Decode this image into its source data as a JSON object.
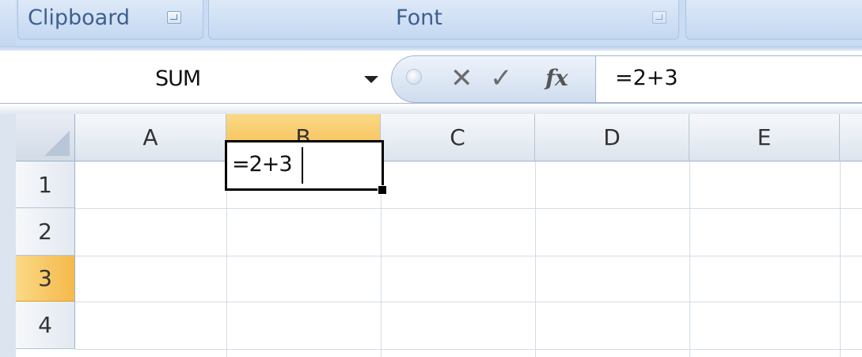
{
  "ribbon": {
    "groups": [
      {
        "label": "Clipboard"
      },
      {
        "label": "Font"
      }
    ]
  },
  "formula_bar": {
    "name_box_value": "SUM",
    "cancel_glyph": "✕",
    "enter_glyph": "✓",
    "fx_label": "fx",
    "formula": "=2+3"
  },
  "grid": {
    "columns": [
      "A",
      "B",
      "C",
      "D",
      "E"
    ],
    "rows": [
      "1",
      "2",
      "3",
      "4"
    ],
    "selected_column": "B",
    "selected_row": "3",
    "active_cell_text": "=2+3"
  },
  "colors": {
    "selected_header": "#f5b94a",
    "ribbon_bg": "#c9dcf3",
    "ribbon_text": "#3e5f8f"
  },
  "icons": [
    "dialog-launcher-icon",
    "dropdown-arrow-icon",
    "cancel-icon",
    "enter-icon",
    "insert-function-icon",
    "select-all-icon"
  ]
}
